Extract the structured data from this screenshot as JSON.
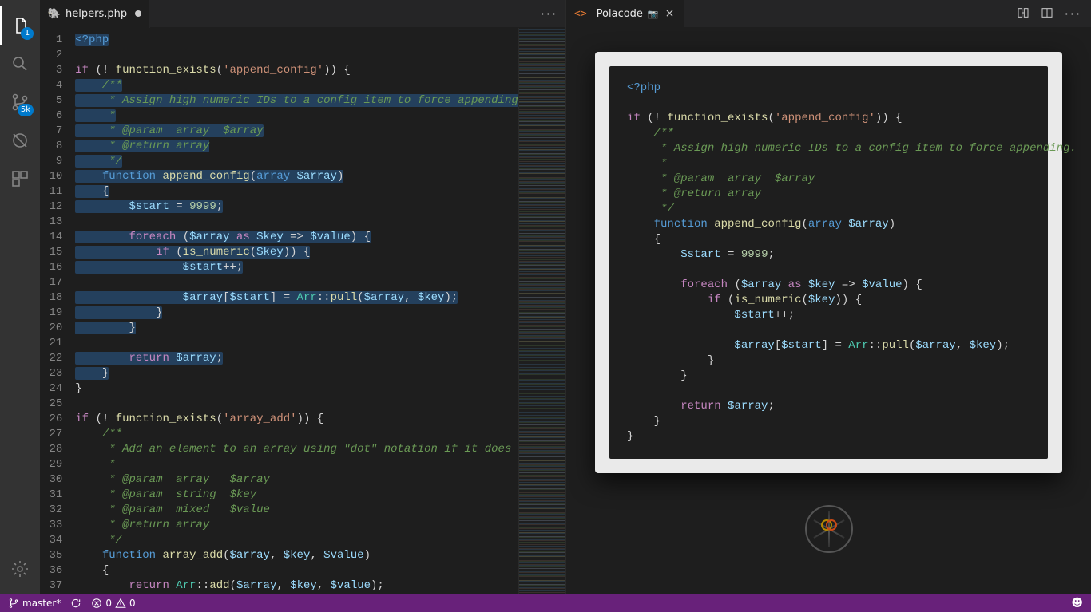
{
  "activity": {
    "explorer_badge": "1",
    "scm_badge": "5k"
  },
  "editor": {
    "tab_filename": "helpers.php",
    "more_label": "···"
  },
  "polacode": {
    "tab_label": "Polacode",
    "camera_glyph": "📷",
    "more_label": "···"
  },
  "status": {
    "branch": "master*",
    "errors": "0",
    "warnings": "0",
    "smile": "☻"
  },
  "code_left": [
    "<span class='sel'><span class='k'>&lt;?php</span></span>",
    "",
    "<span class='kc'>if</span> <span class='op'>(!</span> <span class='fn'>function_exists</span><span class='op'>(</span><span class='s'>'append_config'</span><span class='op'>)) {</span>",
    "<span class='sel'>    <span class='c'>/**</span></span>",
    "<span class='sel'>     <span class='c'>* Assign high numeric IDs to a config item to force appending</span></span>",
    "<span class='sel'>     <span class='c'>*</span></span>",
    "<span class='sel'>     <span class='c'>* @param  array  $array</span></span>",
    "<span class='sel'>     <span class='c'>* @return array</span></span>",
    "<span class='sel'>     <span class='c'>*/</span></span>",
    "<span class='sel'>    <span class='k'>function</span> <span class='fn'>append_config</span><span class='op'>(</span><span class='k'>array</span> <span class='v'>$array</span><span class='op'>)</span></span>",
    "<span class='sel'>    <span class='op'>{</span></span>",
    "<span class='sel'>        <span class='v'>$start</span> <span class='op'>=</span> <span class='n'>9999</span><span class='op'>;</span></span>",
    "",
    "<span class='sel'>        <span class='kc'>foreach</span> <span class='op'>(</span><span class='v'>$array</span> <span class='kc'>as</span> <span class='v'>$key</span> <span class='op'>=&gt;</span> <span class='v'>$value</span><span class='op'>) {</span></span>",
    "<span class='sel'>            <span class='kc'>if</span> <span class='op'>(</span><span class='fn'>is_numeric</span><span class='op'>(</span><span class='v'>$key</span><span class='op'>)) {</span></span>",
    "<span class='sel'>                <span class='v'>$start</span><span class='op'>++;</span></span>",
    "",
    "<span class='sel'>                <span class='v'>$array</span><span class='op'>[</span><span class='v'>$start</span><span class='op'>] =</span> <span class='cl'>Arr</span><span class='op'>::</span><span class='fn'>pull</span><span class='op'>(</span><span class='v'>$array</span><span class='op'>,</span> <span class='v'>$key</span><span class='op'>);</span></span>",
    "<span class='sel'>            <span class='op'>}</span></span>",
    "<span class='sel'>        <span class='op'>}</span></span>",
    "",
    "<span class='sel'>        <span class='kc'>return</span> <span class='v'>$array</span><span class='op'>;</span></span>",
    "<span class='sel'>    <span class='op'>}</span></span>",
    "<span class='op'>}</span>",
    "",
    "<span class='kc'>if</span> <span class='op'>(!</span> <span class='fn'>function_exists</span><span class='op'>(</span><span class='s'>'array_add'</span><span class='op'>)) {</span>",
    "    <span class='c'>/**</span>",
    "    <span class='c'> * Add an element to an array using &quot;dot&quot; notation if it does</span>",
    "    <span class='c'> *</span>",
    "    <span class='c'> * @param  array   $array</span>",
    "    <span class='c'> * @param  string  $key</span>",
    "    <span class='c'> * @param  mixed   $value</span>",
    "    <span class='c'> * @return array</span>",
    "    <span class='c'> */</span>",
    "    <span class='k'>function</span> <span class='fn'>array_add</span><span class='op'>(</span><span class='v'>$array</span><span class='op'>,</span> <span class='v'>$key</span><span class='op'>,</span> <span class='v'>$value</span><span class='op'>)</span>",
    "    <span class='op'>{</span>",
    "        <span class='kc'>return</span> <span class='cl'>Arr</span><span class='op'>::</span><span class='fn'>add</span><span class='op'>(</span><span class='v'>$array</span><span class='op'>,</span> <span class='v'>$key</span><span class='op'>,</span> <span class='v'>$value</span><span class='op'>);</span>"
  ],
  "code_right": [
    "<span class='k'>&lt;?php</span>",
    "",
    "<span class='kc'>if</span> <span class='op'>(!</span> <span class='fn'>function_exists</span><span class='op'>(</span><span class='s'>'append_config'</span><span class='op'>)) {</span>",
    "    <span class='c'>/**</span>",
    "    <span class='c'> * Assign high numeric IDs to a config item to force appending.</span>",
    "    <span class='c'> *</span>",
    "    <span class='c'> * @param  array  $array</span>",
    "    <span class='c'> * @return array</span>",
    "    <span class='c'> */</span>",
    "    <span class='k'>function</span> <span class='fn'>append_config</span><span class='op'>(</span><span class='k'>array</span> <span class='v'>$array</span><span class='op'>)</span>",
    "    <span class='op'>{</span>",
    "        <span class='v'>$start</span> <span class='op'>=</span> <span class='n'>9999</span><span class='op'>;</span>",
    "",
    "        <span class='kc'>foreach</span> <span class='op'>(</span><span class='v'>$array</span> <span class='kc'>as</span> <span class='v'>$key</span> <span class='op'>=&gt;</span> <span class='v'>$value</span><span class='op'>) {</span>",
    "            <span class='kc'>if</span> <span class='op'>(</span><span class='fn'>is_numeric</span><span class='op'>(</span><span class='v'>$key</span><span class='op'>)) {</span>",
    "                <span class='v'>$start</span><span class='op'>++;</span>",
    "",
    "                <span class='v'>$array</span><span class='op'>[</span><span class='v'>$start</span><span class='op'>] =</span> <span class='cl'>Arr</span><span class='op'>::</span><span class='fn'>pull</span><span class='op'>(</span><span class='v'>$array</span><span class='op'>,</span> <span class='v'>$key</span><span class='op'>);</span>",
    "            <span class='op'>}</span>",
    "        <span class='op'>}</span>",
    "",
    "        <span class='kc'>return</span> <span class='v'>$array</span><span class='op'>;</span>",
    "    <span class='op'>}</span>",
    "<span class='op'>}</span>"
  ]
}
